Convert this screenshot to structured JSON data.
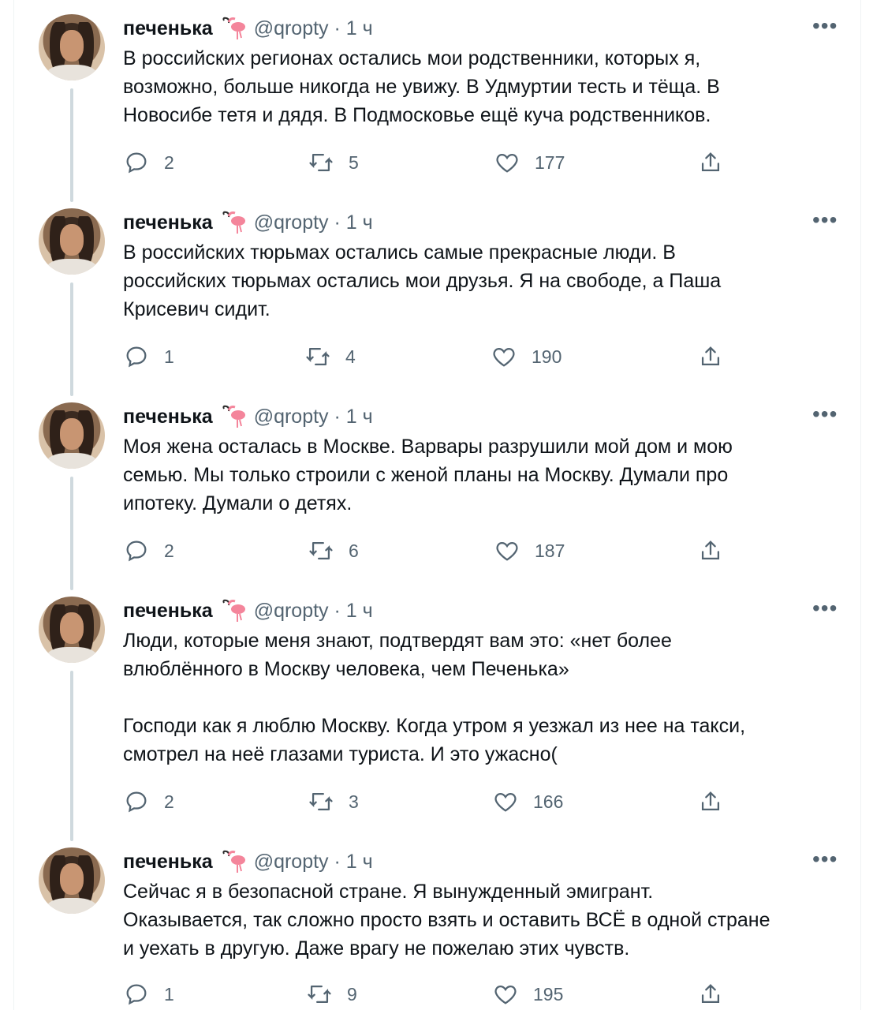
{
  "tweets": [
    {
      "name": "печенька",
      "handle": "@qropty · 1 ч",
      "text": "В российских регионах остались мои родственники, которых я,\nвозможно, больше никогда не увижу. В Удмуртии тесть и тёща. В\nНовосибе тетя и дядя. В Подмосковье ещё куча родственников.",
      "replies": "2",
      "retweets": "5",
      "likes": "177"
    },
    {
      "name": "печенька",
      "handle": "@qropty · 1 ч",
      "text": "В российских тюрьмах остались самые прекрасные люди. В\nроссийских тюрьмах остались мои друзья. Я на свободе, а Паша\nКрисевич сидит.",
      "replies": "1",
      "retweets": "4",
      "likes": "190"
    },
    {
      "name": "печенька",
      "handle": "@qropty · 1 ч",
      "text": "Моя жена осталась в Москве. Варвары разрушили мой дом и мою\nсемью. Мы только строили с женой планы на Москву. Думали про\nипотеку. Думали о детях.",
      "replies": "2",
      "retweets": "6",
      "likes": "187"
    },
    {
      "name": "печенька",
      "handle": "@qropty · 1 ч",
      "text": "Люди, которые меня знают, подтвердят вам это: «нет более\nвлюблённого в Москву человека, чем Печенька»\n\nГосподи как я люблю Москву. Когда утром я уезжал из нее на такси,\nсмотрел на неё глазами туриста. И это ужасно(",
      "replies": "2",
      "retweets": "3",
      "likes": "166"
    },
    {
      "name": "печенька",
      "handle": "@qropty · 1 ч",
      "text": "Сейчас я в безопасной стране. Я вынужденный эмигрант.\nОказывается, так сложно просто взять и оставить ВСЁ в одной стране\nи уехать в другую. Даже врагу не пожелаю этих чувств.",
      "replies": "1",
      "retweets": "9",
      "likes": "195"
    }
  ],
  "more_label": "•••",
  "colors": {
    "text": "#0f1419",
    "secondary": "#536471",
    "thread_line": "#cfd9de",
    "flamingo": "#f4859b"
  },
  "icons": [
    "reply-icon",
    "retweet-icon",
    "like-icon",
    "share-icon",
    "more-icon",
    "flamingo-emoji-icon"
  ]
}
